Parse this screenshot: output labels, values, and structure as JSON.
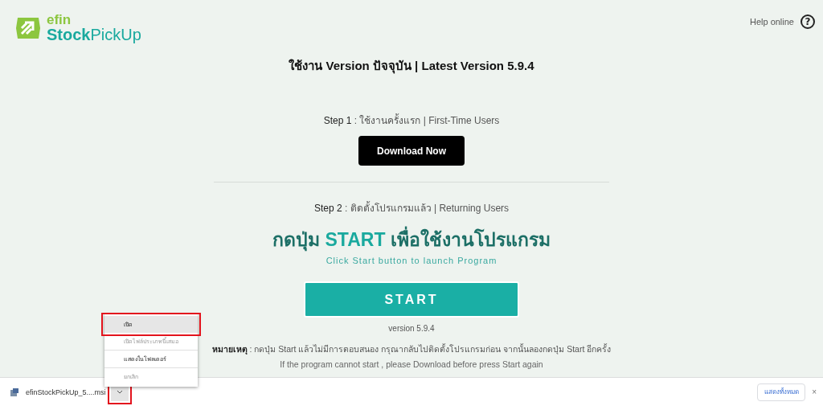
{
  "header": {
    "logo": {
      "brand_top": "efin",
      "brand_bottom_bold": "Stock",
      "brand_bottom_light": "PickUp"
    },
    "help_link": "Help online",
    "help_icon_text": "?"
  },
  "title": "ใช้งาน Version ปัจจุบัน | Latest Version 5.9.4",
  "step1": {
    "label": "Step 1",
    "text": ": ใช้งานครั้งแรก | First-Time Users",
    "button": "Download Now"
  },
  "step2": {
    "label": "Step 2",
    "text": ": ติดตั้งโปรแกรมแล้ว | Returning Users",
    "heading": "กดปุ่ม **START** เพื่อใช้งานโปรแกรม",
    "subheading": "Click Start button to launch Program",
    "button": "START",
    "version": "version 5.9.4"
  },
  "note": {
    "label": "หมายเหตุ",
    "text": ": กดปุ่ม Start แล้วไม่มีการตอบสนอง กรุณากลับไปติดตั้งโปรแกรมก่อน จากนั้นลองกดปุ่ม Start อีกครั้ง",
    "english": "If the program cannot start , please Download before press Start again"
  },
  "download_bar": {
    "file_name": "efinStockPickUp_5....msi",
    "menu_button_highlighted": true,
    "show_all": "แสดงทั้งหมด",
    "close": "×",
    "menu": [
      {
        "label": "เปิด",
        "highlighted": true,
        "disabled": false
      },
      {
        "label": "เปิดไฟล์ประเภทนี้เสมอ",
        "highlighted": false,
        "disabled": true
      },
      {
        "label": "แสดงในโฟลเดอร์",
        "highlighted": false,
        "disabled": false
      },
      {
        "label": "ยกเลิก",
        "highlighted": false,
        "disabled": true
      }
    ]
  }
}
